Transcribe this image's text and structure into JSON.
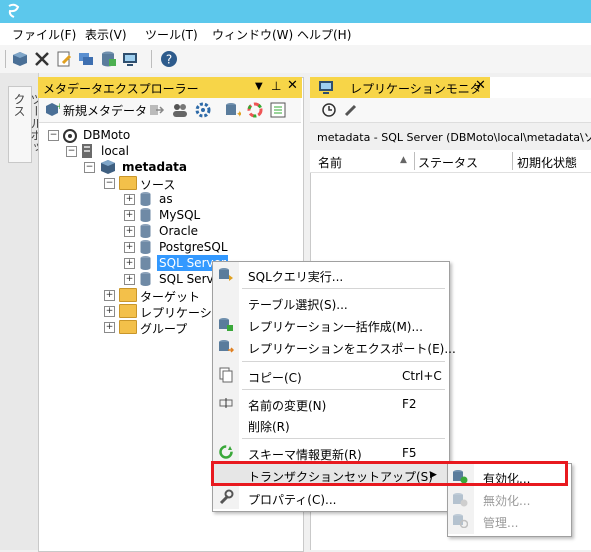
{
  "menubar": {
    "items": [
      {
        "label": "ファイル(F)"
      },
      {
        "label": "表示(V)"
      },
      {
        "label": "ツール(T)"
      },
      {
        "label": "ウィンドウ(W)"
      },
      {
        "label": "ヘルプ(H)"
      }
    ]
  },
  "left_strip": {
    "tab_label": "ツールボックス"
  },
  "explorer": {
    "title": "メタデータエクスプローラー",
    "new_metadata_label": "新規メタデータ",
    "tree": {
      "root": "DBMoto",
      "local": "local",
      "metadata": "metadata",
      "sources": "ソース",
      "as": "as",
      "mysql": "MySQL",
      "oracle": "Oracle",
      "postgresql": "PostgreSQL",
      "sqlserver1": "SQL Server",
      "sqlserver2": "SQL Server",
      "target": "ターゲット",
      "replication": "レプリケーション",
      "group": "グループ"
    }
  },
  "replication_monitor": {
    "title": "レプリケーションモニター",
    "path": "metadata - SQL Server (DBMoto\\local\\metadata\\ソース\\",
    "columns": [
      "名前",
      "ステータス",
      "初期化状態"
    ]
  },
  "context_menu": {
    "items": [
      {
        "label": "SQLクエリ実行...",
        "shortcut": ""
      },
      {
        "label": "テーブル選択(S)...",
        "shortcut": ""
      },
      {
        "label": "レプリケーション一括作成(M)...",
        "shortcut": ""
      },
      {
        "label": "レプリケーションをエクスポート(E)...",
        "shortcut": ""
      },
      {
        "label": "コピー(C)",
        "shortcut": "Ctrl+C"
      },
      {
        "label": "名前の変更(N)",
        "shortcut": "F2"
      },
      {
        "label": "削除(R)",
        "shortcut": ""
      },
      {
        "label": "スキーマ情報更新(R)",
        "shortcut": "F5"
      },
      {
        "label": "トランザクションセットアップ(S)",
        "shortcut": ""
      },
      {
        "label": "プロパティ(C)...",
        "shortcut": ""
      }
    ]
  },
  "submenu": {
    "items": [
      {
        "label": "有効化...",
        "enabled": true
      },
      {
        "label": "無効化...",
        "enabled": false
      },
      {
        "label": "管理...",
        "enabled": false
      }
    ]
  },
  "colors": {
    "titlebar": "#5cc8ec",
    "panel_header": "#f7d548",
    "highlight_outline": "#e8191f"
  }
}
